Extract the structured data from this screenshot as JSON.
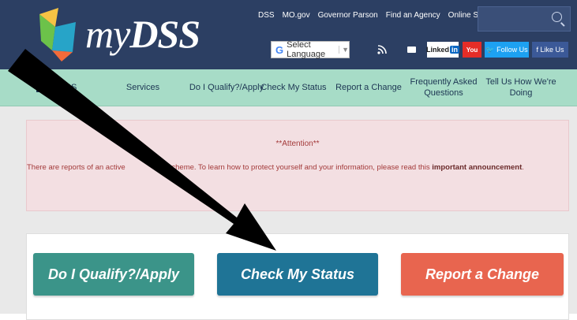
{
  "header": {
    "logo_text_my": "my",
    "logo_text_dss": "DSS",
    "top_links": [
      "DSS",
      "MO.gov",
      "Governor Parson",
      "Find an Agency",
      "Online Services"
    ],
    "search_icon": "search-icon",
    "language_label": "Select Language",
    "language_g": "G",
    "language_caret": "▼",
    "social": {
      "rss": "rss-icon",
      "mail": "mail-icon",
      "linkedin_text": "Linked",
      "linkedin_in": "in",
      "youtube": "You",
      "twitter": "🐦 Follow Us",
      "facebook": "f  Like Us"
    },
    "brand_color": "#2c3f63"
  },
  "nav": {
    "home": "myDSS",
    "items": [
      "Services",
      "Do I Qualify?/Apply",
      "Check My Status",
      "Report a Change",
      "Frequently Asked Questions",
      "Tell Us How We're Doing"
    ],
    "background_color": "#a7dcc7"
  },
  "alert": {
    "title": "**Attention**",
    "body_prefix": "There are reports of an active",
    "body_middle": "scheme. To learn how to protect yourself and your information, please read this",
    "body_link": "important announcement",
    "body_suffix": "."
  },
  "actions": {
    "apply": "Do I Qualify?/Apply",
    "status": "Check My Status",
    "report": "Report a Change",
    "colors": {
      "apply": "#3b9489",
      "status": "#1f7496",
      "report": "#e8654f"
    }
  },
  "annotation": {
    "arrow_icon": "arrow-pointer-icon"
  }
}
